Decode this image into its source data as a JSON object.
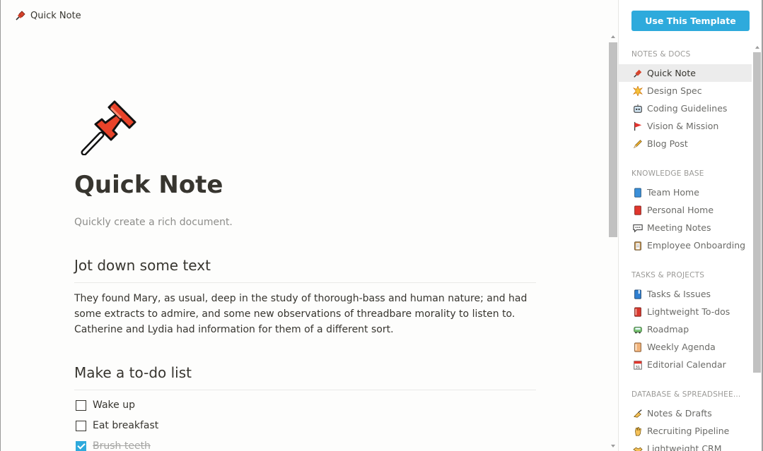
{
  "breadcrumb": {
    "icon": "pushpin-icon",
    "label": "Quick Note"
  },
  "page": {
    "icon": "pushpin-icon",
    "title": "Quick Note",
    "subtitle": "Quickly create a rich document.",
    "section1_heading": "Jot down some text",
    "section1_text": "They found Mary, as usual, deep in the study of thorough-bass and human nature; and had some extracts to admire, and some new observations of threadbare morality to listen to. Catherine and Lydia had information for them of a different sort.",
    "section2_heading": "Make a to-do list",
    "todos": [
      {
        "label": "Wake up",
        "checked": false
      },
      {
        "label": "Eat breakfast",
        "checked": false
      },
      {
        "label": "Brush teeth",
        "checked": true
      }
    ]
  },
  "sidebar": {
    "use_template_label": "Use This Template",
    "sections": [
      {
        "title": "NOTES & DOCS",
        "items": [
          {
            "label": "Quick Note",
            "icon": "pushpin-icon",
            "active": true
          },
          {
            "label": "Design Spec",
            "icon": "burst-icon"
          },
          {
            "label": "Coding Guidelines",
            "icon": "robot-face-icon"
          },
          {
            "label": "Vision & Mission",
            "icon": "red-flag-icon"
          },
          {
            "label": "Blog Post",
            "icon": "pencil-icon"
          }
        ]
      },
      {
        "title": "KNOWLEDGE BASE",
        "items": [
          {
            "label": "Team Home",
            "icon": "blue-book-icon"
          },
          {
            "label": "Personal Home",
            "icon": "red-book-icon"
          },
          {
            "label": "Meeting Notes",
            "icon": "speech-balloon-icon"
          },
          {
            "label": "Employee Onboarding",
            "icon": "clipboard-icon"
          }
        ]
      },
      {
        "title": "TASKS & PROJECTS",
        "items": [
          {
            "label": "Tasks & Issues",
            "icon": "blue-notebook-icon"
          },
          {
            "label": "Lightweight To-dos",
            "icon": "red-notebook-icon"
          },
          {
            "label": "Roadmap",
            "icon": "train-icon"
          },
          {
            "label": "Weekly Agenda",
            "icon": "orange-notebook-icon"
          },
          {
            "label": "Editorial Calendar",
            "icon": "calendar-icon"
          }
        ]
      },
      {
        "title": "DATABASE & SPREADSHEE...",
        "items": [
          {
            "label": "Notes & Drafts",
            "icon": "writing-hand-icon"
          },
          {
            "label": "Recruiting Pipeline",
            "icon": "raised-hand-icon"
          },
          {
            "label": "Lightweight CRM",
            "icon": "handshake-icon"
          }
        ]
      }
    ]
  },
  "colors": {
    "accent": "#2eaadc",
    "text": "#37352f",
    "muted": "#9b9a97"
  }
}
